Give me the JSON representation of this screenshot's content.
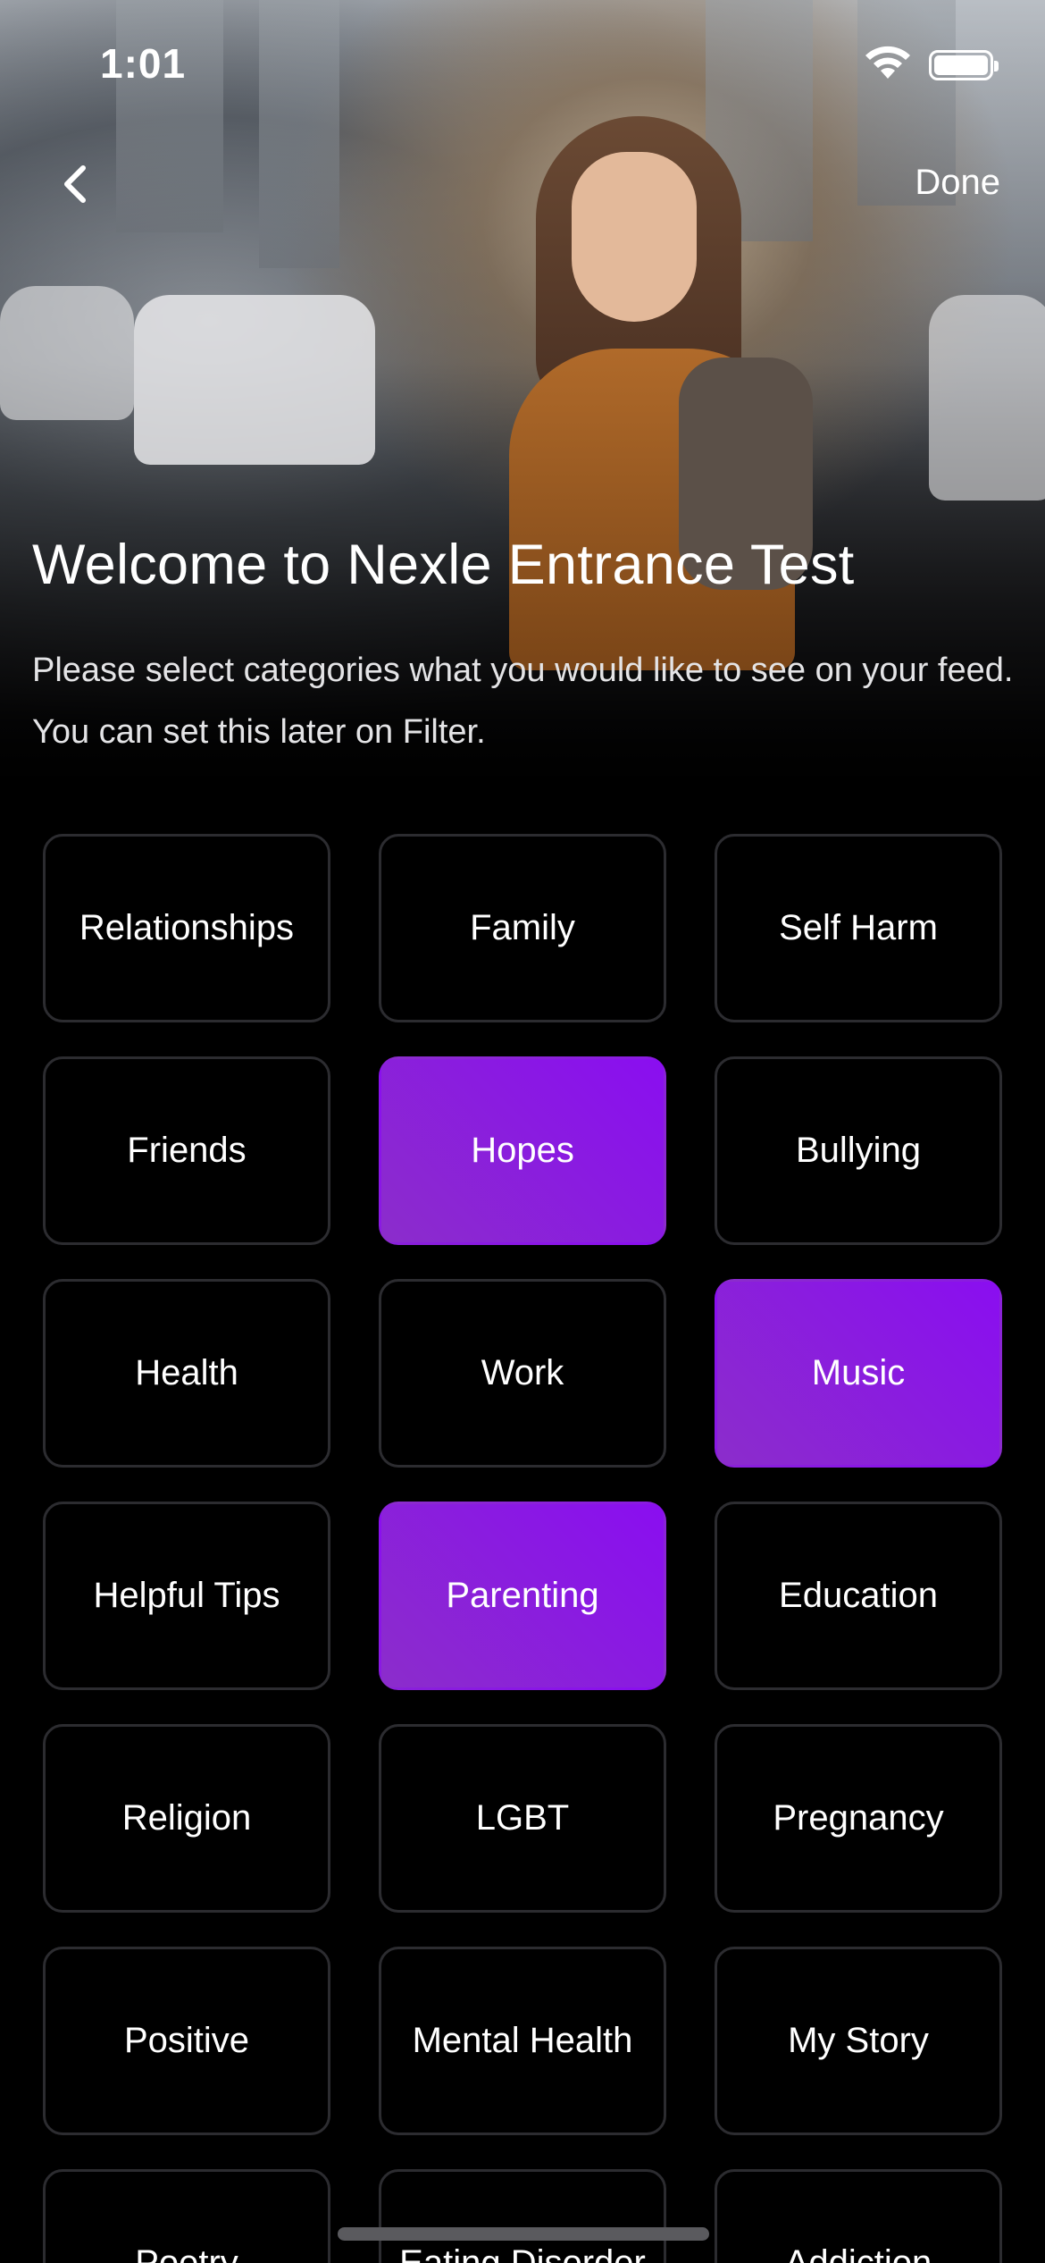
{
  "status_bar": {
    "time": "1:01"
  },
  "nav": {
    "done_label": "Done"
  },
  "header": {
    "title": "Welcome to Nexle Entrance Test",
    "subtitle": "Please select categories what you would like to see on your feed. You can set this later on Filter."
  },
  "colors": {
    "accent_start": "#8a0ef0",
    "accent_end": "#8b2dcb",
    "card_border": "#2c2c30",
    "background": "#000000"
  },
  "categories": [
    {
      "label": "Relationships",
      "selected": false
    },
    {
      "label": "Family",
      "selected": false
    },
    {
      "label": "Self Harm",
      "selected": false
    },
    {
      "label": "Friends",
      "selected": false
    },
    {
      "label": "Hopes",
      "selected": true
    },
    {
      "label": "Bullying",
      "selected": false
    },
    {
      "label": "Health",
      "selected": false
    },
    {
      "label": "Work",
      "selected": false
    },
    {
      "label": "Music",
      "selected": true
    },
    {
      "label": "Helpful Tips",
      "selected": false
    },
    {
      "label": "Parenting",
      "selected": true
    },
    {
      "label": "Education",
      "selected": false
    },
    {
      "label": "Religion",
      "selected": false
    },
    {
      "label": "LGBT",
      "selected": false
    },
    {
      "label": "Pregnancy",
      "selected": false
    },
    {
      "label": "Positive",
      "selected": false
    },
    {
      "label": "Mental Health",
      "selected": false
    },
    {
      "label": "My Story",
      "selected": false
    },
    {
      "label": "Poetry",
      "selected": false
    },
    {
      "label": "Eating Disorder",
      "selected": false
    },
    {
      "label": "Addiction",
      "selected": false
    }
  ]
}
